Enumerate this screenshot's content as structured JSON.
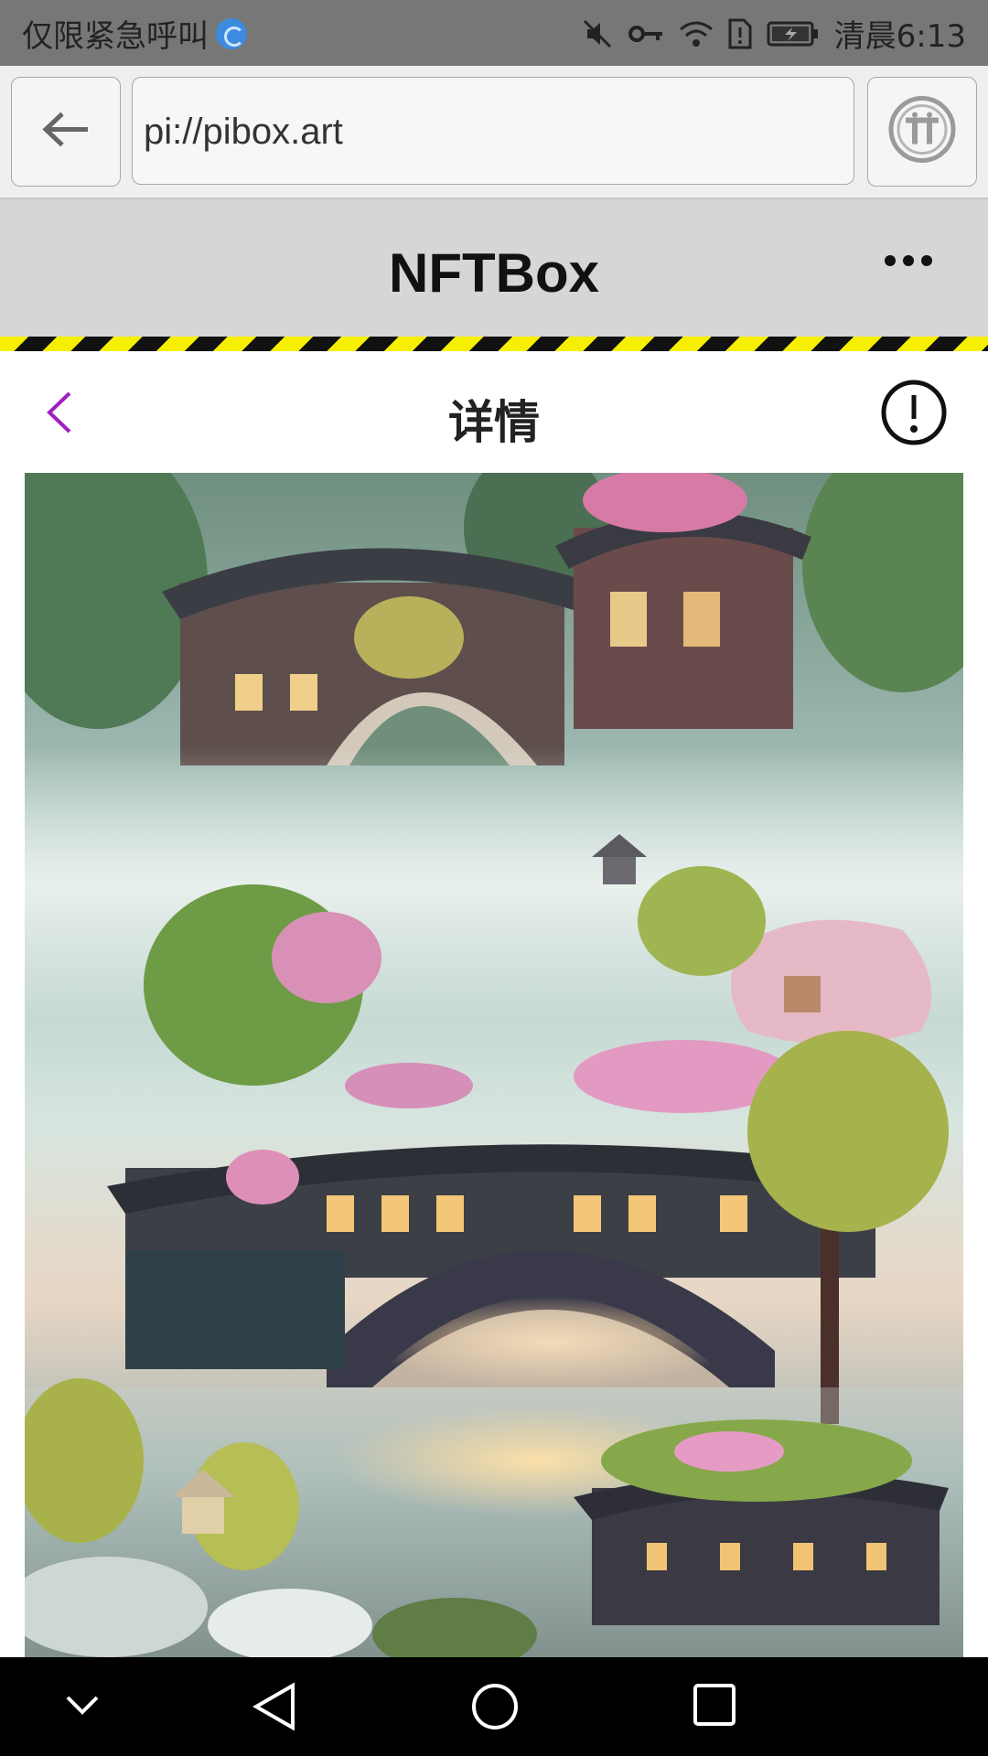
{
  "status_bar": {
    "carrier_text": "仅限紧急呼叫",
    "time_text": "清晨6:13"
  },
  "browser": {
    "url": "pi://pibox.art",
    "back_icon": "arrow-left-icon",
    "pi_icon": "pi-logo-icon"
  },
  "app": {
    "title": "NFTBox",
    "menu_icon": "more-dots-icon"
  },
  "page": {
    "title": "详情",
    "back_icon": "chevron-left-icon",
    "info_icon": "exclamation-circle-icon"
  },
  "artwork": {
    "subject": "misty water town with arched bridges, pavilions and blossoming trees"
  },
  "colors": {
    "status_bar": "#777777",
    "browser_bar": "#efefef",
    "app_header": "#d6d6d6",
    "hazard_yellow": "#f7ef00",
    "back_chevron": "#a020c0",
    "nav_bar": "#000000"
  }
}
